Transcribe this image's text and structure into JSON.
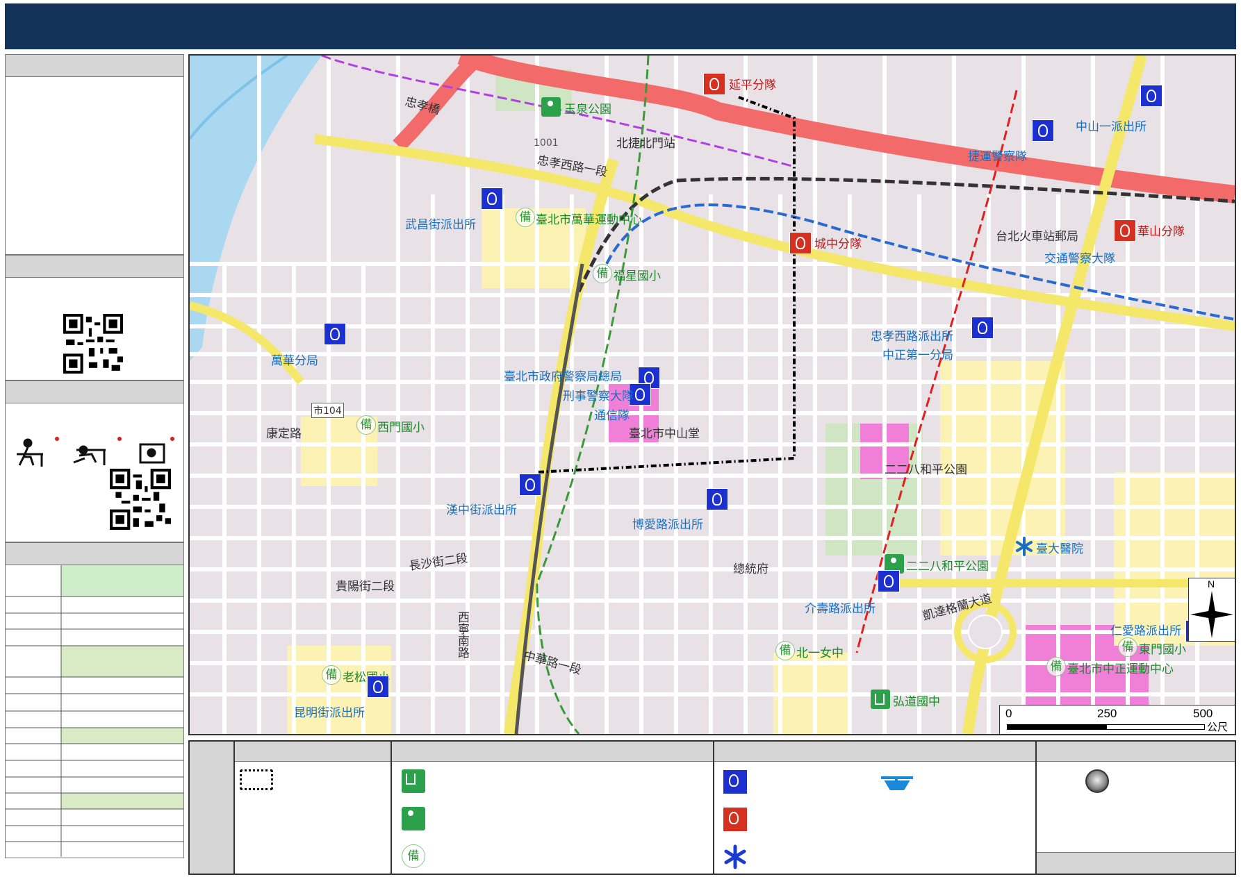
{
  "map": {
    "scale_bar": {
      "ticks": [
        "0",
        "250",
        "500"
      ],
      "unit": "公尺"
    },
    "north_label": "N",
    "labels": {
      "yanping": "延平分隊",
      "yuquan_park": "玉泉公園",
      "wuchang_station": "武昌街派出所",
      "wanhua_sports": "臺北市萬華運動中心",
      "fuxing_school": "福星國小",
      "chengzhong": "城中分隊",
      "huashan": "華山分隊",
      "mrt_police": "捷運警察隊",
      "zhongshan1_station": "中山一派出所",
      "traffic_police": "交通警察大隊",
      "zhongxiao_w_station": "忠孝西路派出所",
      "zhongzheng1": "中正第一分局",
      "wanhua_branch": "萬華分局",
      "police_hq": "臺北市政府警察局總局",
      "criminal": "刑事警察大隊",
      "comm": "通信隊",
      "ximen_school": "西門國小",
      "hanzhong_station": "漢中街派出所",
      "boai_station": "博愛路派出所",
      "park_228": "二二八和平公園",
      "ntuh": "臺大醫院",
      "jieshou_station": "介壽路派出所",
      "beiyinu": "北一女中",
      "hongdao": "弘道國中",
      "laosong": "老松國小",
      "kunming_station": "昆明街派出所",
      "renai_station": "仁愛路派出所",
      "dongmen_school": "東門國小",
      "zhongzheng_sports": "臺北市中正運動中心",
      "zhongxiao_bridge": "忠孝橋",
      "zhongxiao_w_road": "忠孝西路一段",
      "beimen": "北捷北門站",
      "taipei_station": "台北火車站郵局",
      "zhonghua_rd": "中華路一段",
      "changsha_rd": "長沙街二段",
      "guiyang_rd": "貴陽街二段",
      "kaida": "凱達格蘭大道",
      "presidential": "總統府",
      "xining": "西寧南路",
      "kangding": "康定路",
      "zhongshan_hall": "臺北市中山堂",
      "chenggong_park": "二二八和平公園",
      "route_104": "市104",
      "road_1001": "1001"
    }
  },
  "colors": {
    "title_bar": "#12325a",
    "river": "#a9d8f0",
    "highway": "#f26a6a",
    "main_road": "#f5e76a",
    "school_zone": "#fbf2b3",
    "green": "#cfe5c4",
    "police": "#1c2fd0",
    "fire": "#d63020"
  },
  "icons": [
    "police-icon",
    "fire-icon",
    "park-icon",
    "shelter-icon",
    "bei-icon",
    "hospital-icon",
    "helipad-icon",
    "gray-circle-icon",
    "boundary-icon",
    "north-arrow-icon",
    "qr-code-icon"
  ]
}
